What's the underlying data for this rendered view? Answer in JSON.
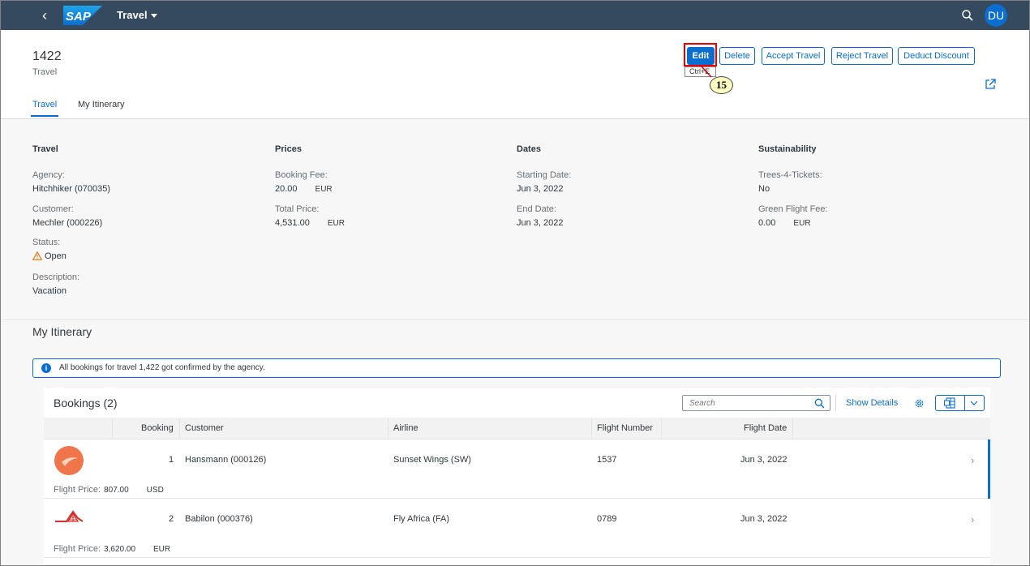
{
  "shell": {
    "app_title": "Travel",
    "user_initials": "DU",
    "logo_text": "SAP"
  },
  "header": {
    "object_title": "1422",
    "object_subtitle": "Travel",
    "actions": {
      "edit": "Edit",
      "delete": "Delete",
      "accept": "Accept Travel",
      "reject": "Reject Travel",
      "deduct": "Deduct Discount"
    },
    "edit_tooltip": "Ctrl+E",
    "step_badge": "15",
    "tabs": [
      {
        "label": "Travel",
        "active": true
      },
      {
        "label": "My Itinerary",
        "active": false
      }
    ]
  },
  "facets": {
    "travel": {
      "title": "Travel",
      "agency_label": "Agency:",
      "agency_value": "Hitchhiker (070035)",
      "customer_label": "Customer:",
      "customer_value": "Mechler (000226)",
      "status_label": "Status:",
      "status_value": "Open",
      "description_label": "Description:",
      "description_value": "Vacation"
    },
    "prices": {
      "title": "Prices",
      "booking_fee_label": "Booking Fee:",
      "booking_fee_value": "20.00",
      "booking_fee_currency": "EUR",
      "total_price_label": "Total Price:",
      "total_price_value": "4,531.00",
      "total_price_currency": "EUR"
    },
    "dates": {
      "title": "Dates",
      "start_label": "Starting Date:",
      "start_value": "Jun 3, 2022",
      "end_label": "End Date:",
      "end_value": "Jun 3, 2022"
    },
    "sustainability": {
      "title": "Sustainability",
      "trees_label": "Trees-4-Tickets:",
      "trees_value": "No",
      "green_fee_label": "Green Flight Fee:",
      "green_fee_value": "0.00",
      "green_fee_currency": "EUR"
    }
  },
  "itinerary": {
    "section_title": "My Itinerary",
    "message": "All bookings for travel 1,422 got confirmed by the agency.",
    "table_title": "Bookings (2)",
    "search_placeholder": "Search",
    "show_details": "Show Details",
    "columns": [
      "Booking",
      "Customer",
      "Airline",
      "Flight Number",
      "Flight Date"
    ],
    "flight_price_label": "Flight Price:",
    "rows": [
      {
        "booking": "1",
        "customer": "Hansmann (000126)",
        "airline": "Sunset Wings (SW)",
        "flight_number": "1537",
        "flight_date": "Jun 3, 2022",
        "price": "807.00",
        "currency": "USD",
        "logo": "sunset-wings-logo",
        "selected": true
      },
      {
        "booking": "2",
        "customer": "Babilon (000376)",
        "airline": "Fly Africa (FA)",
        "flight_number": "0789",
        "flight_date": "Jun 3, 2022",
        "price": "3,620.00",
        "currency": "EUR",
        "logo": "fly-africa-logo",
        "selected": false
      }
    ]
  },
  "colors": {
    "shell": "#354a5f",
    "accent": "#0a6ed1",
    "warning": "#e9730c",
    "highlight": "#ee0000"
  }
}
